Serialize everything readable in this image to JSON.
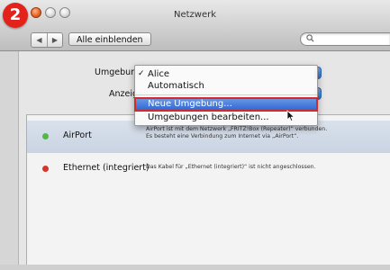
{
  "step_badge": "2",
  "window": {
    "title": "Netzwerk"
  },
  "toolbar": {
    "back_label": "◀",
    "forward_label": "▶",
    "show_all_label": "Alle einblenden",
    "search_placeholder": "",
    "search_icon": "magnifier-icon"
  },
  "form": {
    "location_label": "Umgebung",
    "show_label": "Anzeigen"
  },
  "dropdown": {
    "items": [
      {
        "label": "Alice",
        "checked": true
      },
      {
        "label": "Automatisch",
        "checked": false
      },
      {
        "label": "Neue Umgebung...",
        "checked": false,
        "highlighted": true
      },
      {
        "label": "Umgebungen bearbeiten...",
        "checked": false
      }
    ],
    "check_mark": "✓",
    "highlight_color": "#3a70d6",
    "highlight_outline": "#d42a2a"
  },
  "services": [
    {
      "name": "AirPort",
      "status_color": "#53b84a",
      "description_line1": "AirPort ist mit dem Netzwerk „FRITZ!Box (Repeater)“ verbunden.",
      "description_line2": "Es besteht eine Verbindung zum Internet via „AirPort“."
    },
    {
      "name": "Ethernet (integriert)",
      "status_color": "#d8352a",
      "description_line1": "Das Kabel für „Ethernet (integriert)“ ist nicht angeschlossen."
    }
  ],
  "colors": {
    "badge": "#e3231b",
    "popup_blue": "#2b6fd0"
  }
}
